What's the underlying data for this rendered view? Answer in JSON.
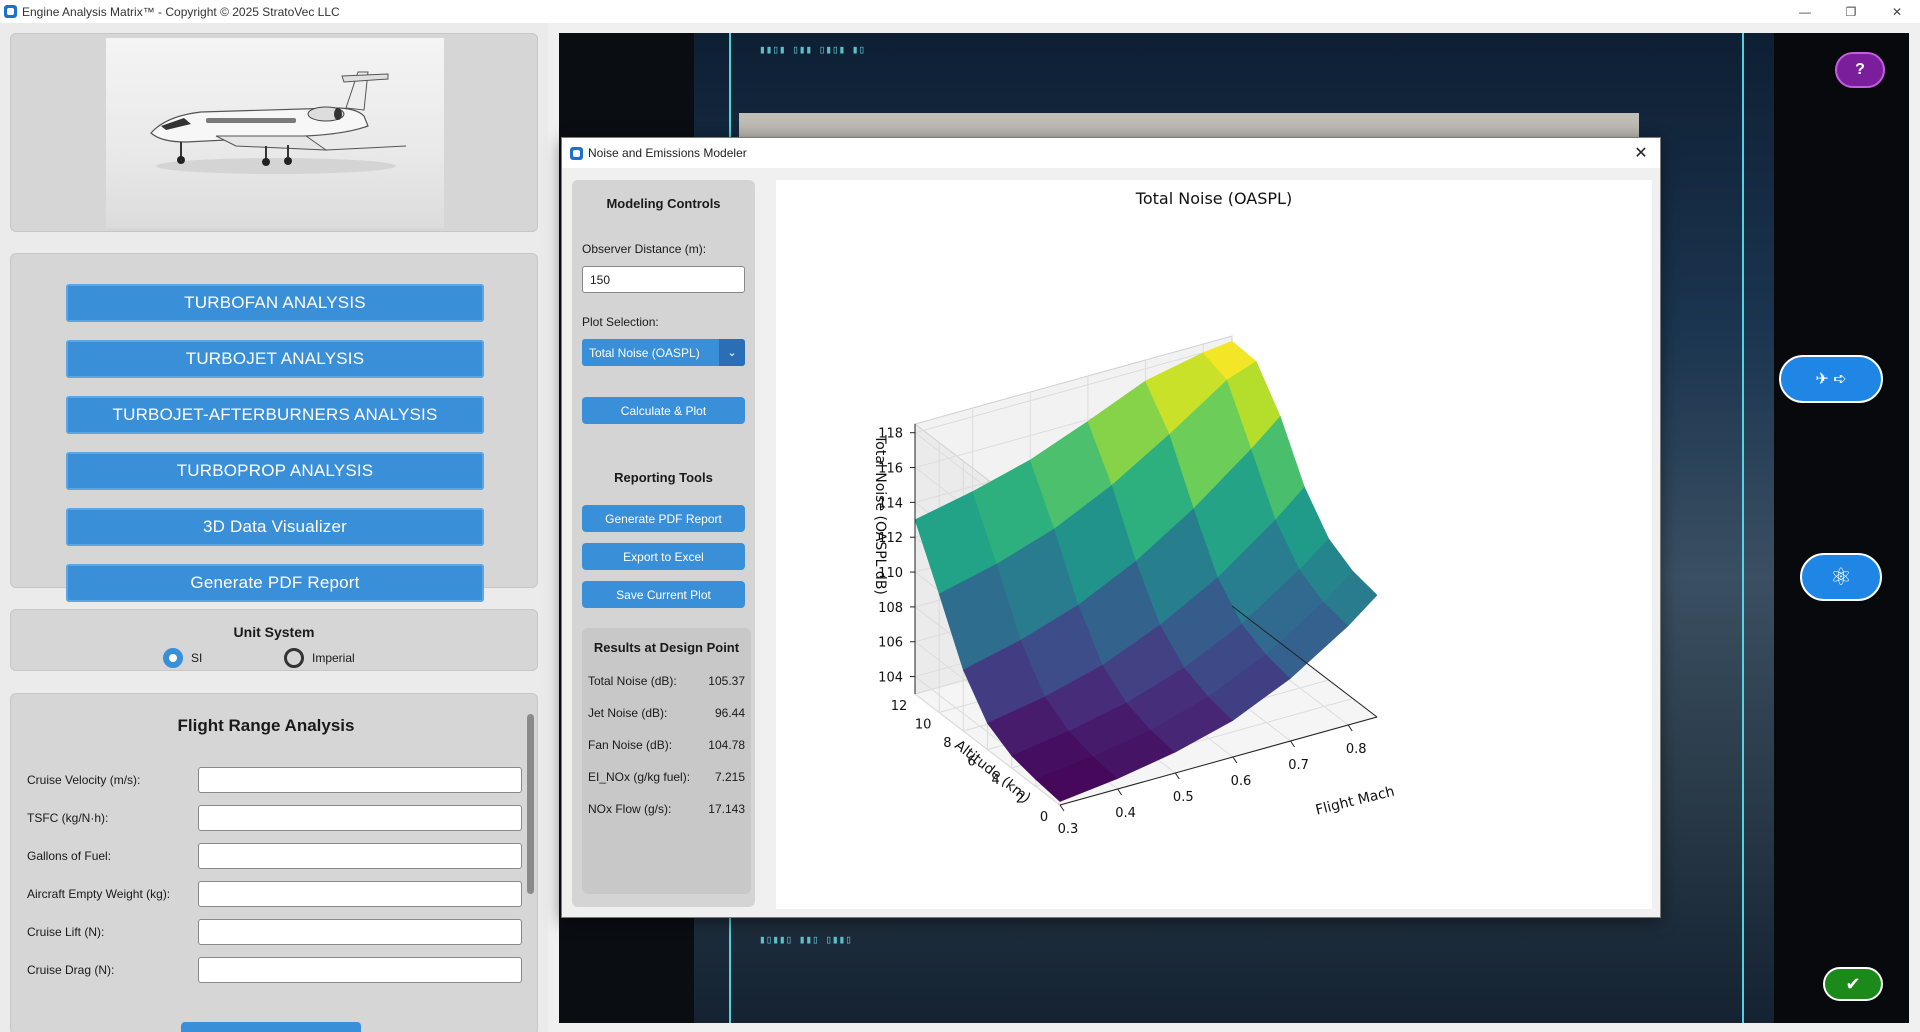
{
  "window": {
    "title": "Engine Analysis Matrix™ - Copyright © 2025 StratoVec LLC",
    "minimize": "—",
    "maximize": "❐",
    "close": "✕"
  },
  "sidebar": {
    "nav_buttons": [
      {
        "label": "TURBOFAN ANALYSIS"
      },
      {
        "label": "TURBOJET ANALYSIS"
      },
      {
        "label": "TURBOJET-AFTERBURNERS ANALYSIS"
      },
      {
        "label": "TURBOPROP ANALYSIS"
      },
      {
        "label": "3D Data Visualizer"
      },
      {
        "label": "Generate PDF Report"
      }
    ],
    "units": {
      "title": "Unit System",
      "options": [
        "SI",
        "Imperial"
      ],
      "selected": "SI"
    },
    "flight_range": {
      "title": "Flight Range Analysis",
      "fields": [
        {
          "label": "Cruise Velocity (m/s):",
          "value": ""
        },
        {
          "label": "TSFC (kg/N·h):",
          "value": ""
        },
        {
          "label": "Gallons of Fuel:",
          "value": ""
        },
        {
          "label": "Aircraft Empty Weight (kg):",
          "value": ""
        },
        {
          "label": "Cruise Lift (N):",
          "value": ""
        },
        {
          "label": "Cruise Drag (N):",
          "value": ""
        }
      ]
    }
  },
  "right_controls": {
    "help": "?",
    "fly_icons": "✈ ➪",
    "atom_icon": "⚛",
    "ok": "✔",
    "colors": {
      "help": "#7a1e9c",
      "blue": "#1f86e6",
      "ok": "#1b8a1b"
    }
  },
  "dialog": {
    "title": "Noise and Emissions Modeler",
    "close": "✕",
    "controls": {
      "heading": "Modeling Controls",
      "observer_label": "Observer Distance (m):",
      "observer_value": "150",
      "plot_label": "Plot Selection:",
      "plot_value": "Total Noise (OASPL)",
      "calc_button": "Calculate & Plot",
      "reporting_heading": "Reporting Tools",
      "report_buttons": [
        "Generate PDF Report",
        "Export to Excel",
        "Save Current Plot"
      ]
    },
    "results": {
      "title": "Results at Design Point",
      "rows": [
        {
          "label": "Total Noise (dB):",
          "value": "105.37"
        },
        {
          "label": "Jet Noise (dB):",
          "value": "96.44"
        },
        {
          "label": "Fan Noise (dB):",
          "value": "104.78"
        },
        {
          "label": "EI_NOx (g/kg fuel):",
          "value": "7.215"
        },
        {
          "label": "NOx Flow (g/s):",
          "value": "17.143"
        }
      ]
    }
  },
  "chart_data": {
    "type": "surface",
    "title": "Total Noise (OASPL)",
    "xlabel": "Flight Mach",
    "ylabel": "Altitude (km)",
    "zlabel": "Total Noise (OASPL dB)",
    "x_ticks": [
      "0.3",
      "0.4",
      "0.5",
      "0.6",
      "0.7",
      "0.8"
    ],
    "y_ticks": [
      "0",
      "2",
      "4",
      "6",
      "8",
      "10",
      "12"
    ],
    "z_ticks": [
      "104",
      "106",
      "108",
      "110",
      "112",
      "114",
      "116",
      "118"
    ],
    "xlim": [
      0.3,
      0.85
    ],
    "ylim": [
      0,
      12
    ],
    "zlim": [
      103,
      118.5
    ],
    "x": [
      0.3,
      0.4,
      0.5,
      0.6,
      0.7,
      0.8,
      0.85
    ],
    "y": [
      0,
      2,
      4,
      6,
      8,
      10,
      12
    ],
    "z": [
      [
        103.2,
        103.6,
        104.2,
        105.1,
        106.6,
        108.7,
        110.0
      ],
      [
        103.4,
        103.8,
        104.4,
        105.4,
        106.9,
        109.0,
        110.3
      ],
      [
        103.7,
        104.2,
        104.9,
        106.0,
        107.6,
        109.8,
        111.1
      ],
      [
        104.5,
        105.1,
        106.0,
        107.4,
        109.2,
        111.6,
        113.0
      ],
      [
        106.5,
        107.3,
        108.4,
        110.0,
        112.1,
        114.6,
        116.0
      ],
      [
        109.8,
        110.6,
        111.7,
        113.3,
        115.3,
        117.5,
        118.1
      ],
      [
        113.0,
        113.7,
        114.6,
        115.9,
        117.3,
        118.0,
        118.2
      ]
    ],
    "colormap": "viridis",
    "grid": true
  }
}
